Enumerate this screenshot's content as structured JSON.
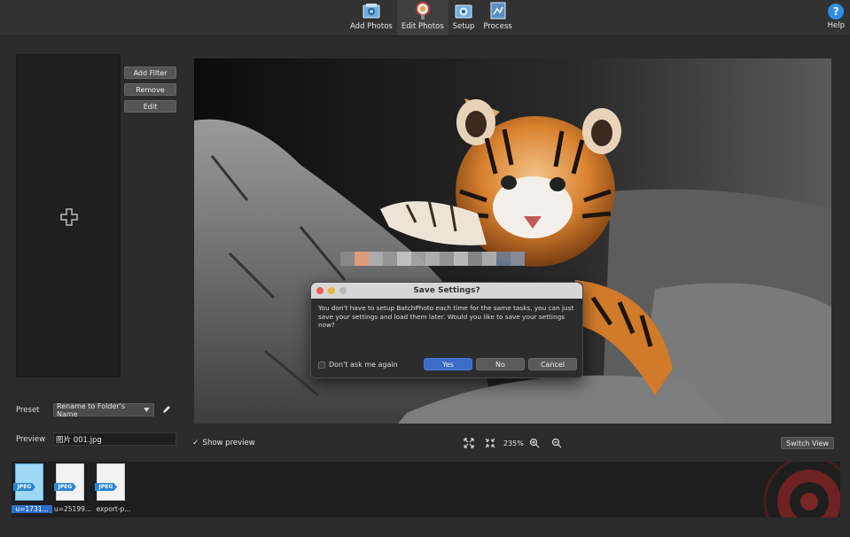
{
  "toolbar": {
    "items": [
      {
        "label": "Add Photos",
        "icon": "add-photos-icon"
      },
      {
        "label": "Edit Photos",
        "icon": "edit-photos-icon",
        "active": true
      },
      {
        "label": "Setup",
        "icon": "setup-icon"
      },
      {
        "label": "Process",
        "icon": "process-icon"
      }
    ],
    "help_label": "Help",
    "help_glyph": "?"
  },
  "filters": {
    "add_label": "Add Filter",
    "remove_label": "Remove",
    "edit_label": "Edit"
  },
  "preset": {
    "label": "Preset",
    "value": "Rename to Folder's Name"
  },
  "preview": {
    "label": "Preview",
    "value": "图片 001.jpg"
  },
  "dialog": {
    "title": "Save Settings?",
    "message": "You don't have to setup BatchPhoto each time for the same tasks, you can just save your settings and load them later. Would you like to save your settings now?",
    "dont_ask_label": "Don't ask me again",
    "yes_label": "Yes",
    "no_label": "No",
    "cancel_label": "Cancel"
  },
  "controls": {
    "show_preview_label": "Show preview",
    "zoom_level": "235%",
    "switch_view_label": "Switch View"
  },
  "filmstrip": {
    "tag": "JPEG",
    "items": [
      {
        "name": "u=1731...",
        "selected": true
      },
      {
        "name": "u=25199...",
        "selected": false
      },
      {
        "name": "export-p...",
        "selected": false
      }
    ]
  },
  "colors": {
    "accent": "#2d6fc8",
    "help": "#2e8ee6",
    "jpeg_tag": "#2b86d4"
  }
}
